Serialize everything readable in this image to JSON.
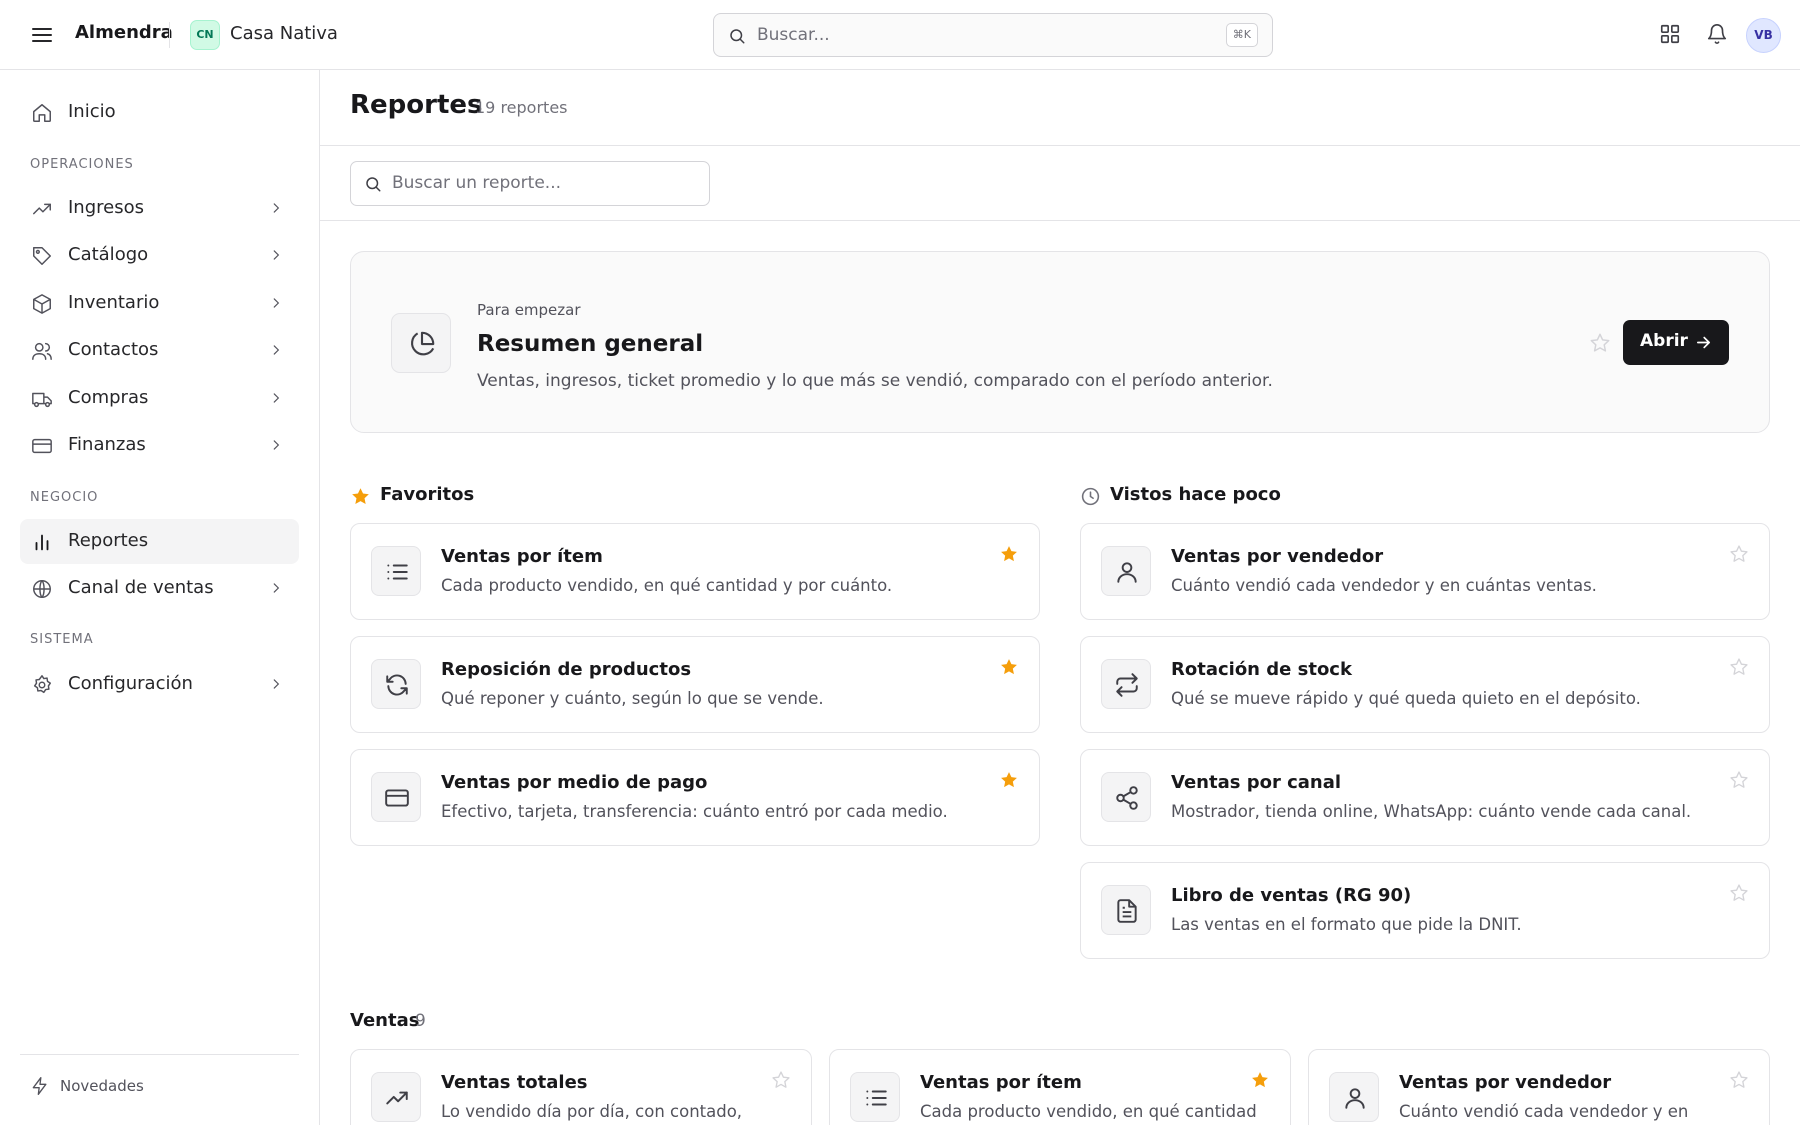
{
  "topbar": {
    "app_name": "Almendra",
    "store_initials": "CN",
    "store_name": "Casa Nativa",
    "search_placeholder": "Buscar...",
    "search_shortcut": "⌘K",
    "user_initials": "VB"
  },
  "sidebar": {
    "home": "Inicio",
    "sections": [
      "OPERACIONES",
      "NEGOCIO",
      "SISTEMA"
    ],
    "items": [
      {
        "label": "Ingresos",
        "icon": "trending-up-icon"
      },
      {
        "label": "Catálogo",
        "icon": "tag-icon"
      },
      {
        "label": "Inventario",
        "icon": "box-icon"
      },
      {
        "label": "Contactos",
        "icon": "users-icon"
      },
      {
        "label": "Compras",
        "icon": "truck-icon"
      },
      {
        "label": "Finanzas",
        "icon": "credit-card-icon"
      },
      {
        "label": "Reportes",
        "icon": "bar-chart-icon",
        "active": true
      },
      {
        "label": "Canal de ventas",
        "icon": "globe-icon"
      },
      {
        "label": "Configuración",
        "icon": "settings-icon"
      }
    ],
    "footer_label": "Novedades"
  },
  "page": {
    "title": "Reportes",
    "count": "19 reportes",
    "search_placeholder": "Buscar un reporte..."
  },
  "hero": {
    "eyebrow": "Para empezar",
    "title": "Resumen general",
    "description": "Ventas, ingresos, ticket promedio y lo que más se vendió, comparado con el período anterior.",
    "button": "Abrir"
  },
  "favorites": {
    "title": "Favoritos",
    "items": [
      {
        "title": "Ventas por ítem",
        "description": "Cada producto vendido, en qué cantidad y por cuánto.",
        "icon": "list-icon",
        "starred": true
      },
      {
        "title": "Reposición de productos",
        "description": "Qué reponer y cuánto, según lo que se vende.",
        "icon": "refresh-icon",
        "starred": true
      },
      {
        "title": "Ventas por medio de pago",
        "description": "Efectivo, tarjeta, transferencia: cuánto entró por cada medio.",
        "icon": "credit-card-icon",
        "starred": true
      }
    ]
  },
  "recent": {
    "title": "Vistos hace poco",
    "items": [
      {
        "title": "Ventas por vendedor",
        "description": "Cuánto vendió cada vendedor y en cuántas ventas.",
        "icon": "user-icon",
        "starred": false
      },
      {
        "title": "Rotación de stock",
        "description": "Qué se mueve rápido y qué queda quieto en el depósito.",
        "icon": "repeat-icon",
        "starred": false
      },
      {
        "title": "Ventas por canal",
        "description": "Mostrador, tienda online, WhatsApp: cuánto vende cada canal.",
        "icon": "share-icon",
        "starred": false
      },
      {
        "title": "Libro de ventas (RG 90)",
        "description": "Las ventas en el formato que pide la DNIT.",
        "icon": "file-text-icon",
        "starred": false
      }
    ]
  },
  "sales": {
    "title": "Ventas",
    "count": "9",
    "items": [
      {
        "title": "Ventas totales",
        "description": "Lo vendido día por día, con contado,",
        "icon": "trending-up-icon",
        "starred": false
      },
      {
        "title": "Ventas por ítem",
        "description": "Cada producto vendido, en qué cantidad",
        "icon": "list-icon",
        "starred": true
      },
      {
        "title": "Ventas por vendedor",
        "description": "Cuánto vendió cada vendedor y en",
        "icon": "user-icon",
        "starred": false
      }
    ]
  },
  "colors": {
    "accent": "#18181b",
    "star_active": "#f59e0b",
    "star_inactive": "#d4d4d8",
    "store_badge": "#d1fae5",
    "avatar_bg": "#e0e7ff"
  }
}
